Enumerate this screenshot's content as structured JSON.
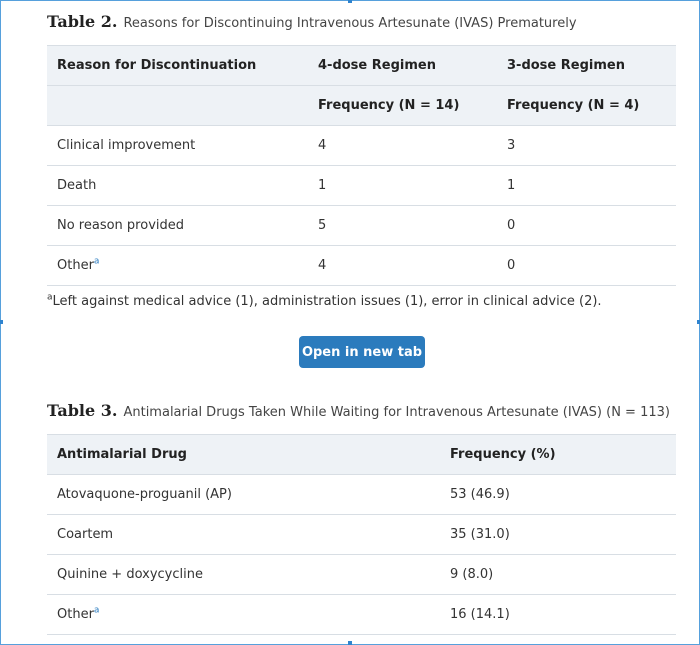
{
  "table2": {
    "label": "Table 2.",
    "title": "Reasons for Discontinuing Intravenous Artesunate (IVAS) Prematurely",
    "headers": [
      "Reason for Discontinuation",
      "4-dose Regimen",
      "3-dose Regimen"
    ],
    "subheaders": [
      "",
      "Frequency (N = 14)",
      "Frequency (N = 4)"
    ],
    "rows": [
      {
        "reason": "Clinical improvement",
        "four": "4",
        "three": "3"
      },
      {
        "reason": "Death",
        "four": "1",
        "three": "1"
      },
      {
        "reason": "No reason provided",
        "four": "5",
        "three": "0"
      },
      {
        "reason": "Other",
        "sup": "a",
        "four": "4",
        "three": "0"
      }
    ],
    "footnote_mark": "a",
    "footnote": "Left against medical advice (1), administration issues (1), error in clinical advice (2)."
  },
  "open_button_label": "Open in new tab",
  "table3": {
    "label": "Table 3.",
    "title": "Antimalarial Drugs Taken While Waiting for Intravenous Artesunate (IVAS) (N = 113)",
    "headers": [
      "Antimalarial Drug",
      "Frequency (%)"
    ],
    "rows": [
      {
        "drug": "Atovaquone-proguanil (AP)",
        "freq": "53 (46.9)"
      },
      {
        "drug": "Coartem",
        "freq": "35 (31.0)"
      },
      {
        "drug": "Quinine + doxycycline",
        "freq": "9 (8.0)"
      },
      {
        "drug": "Other",
        "sup": "a",
        "freq": "16 (14.1)"
      }
    ]
  },
  "colors": {
    "accent": "#2b7bbd",
    "header_bg": "#eef2f6",
    "frame_border": "#56a0dc"
  }
}
